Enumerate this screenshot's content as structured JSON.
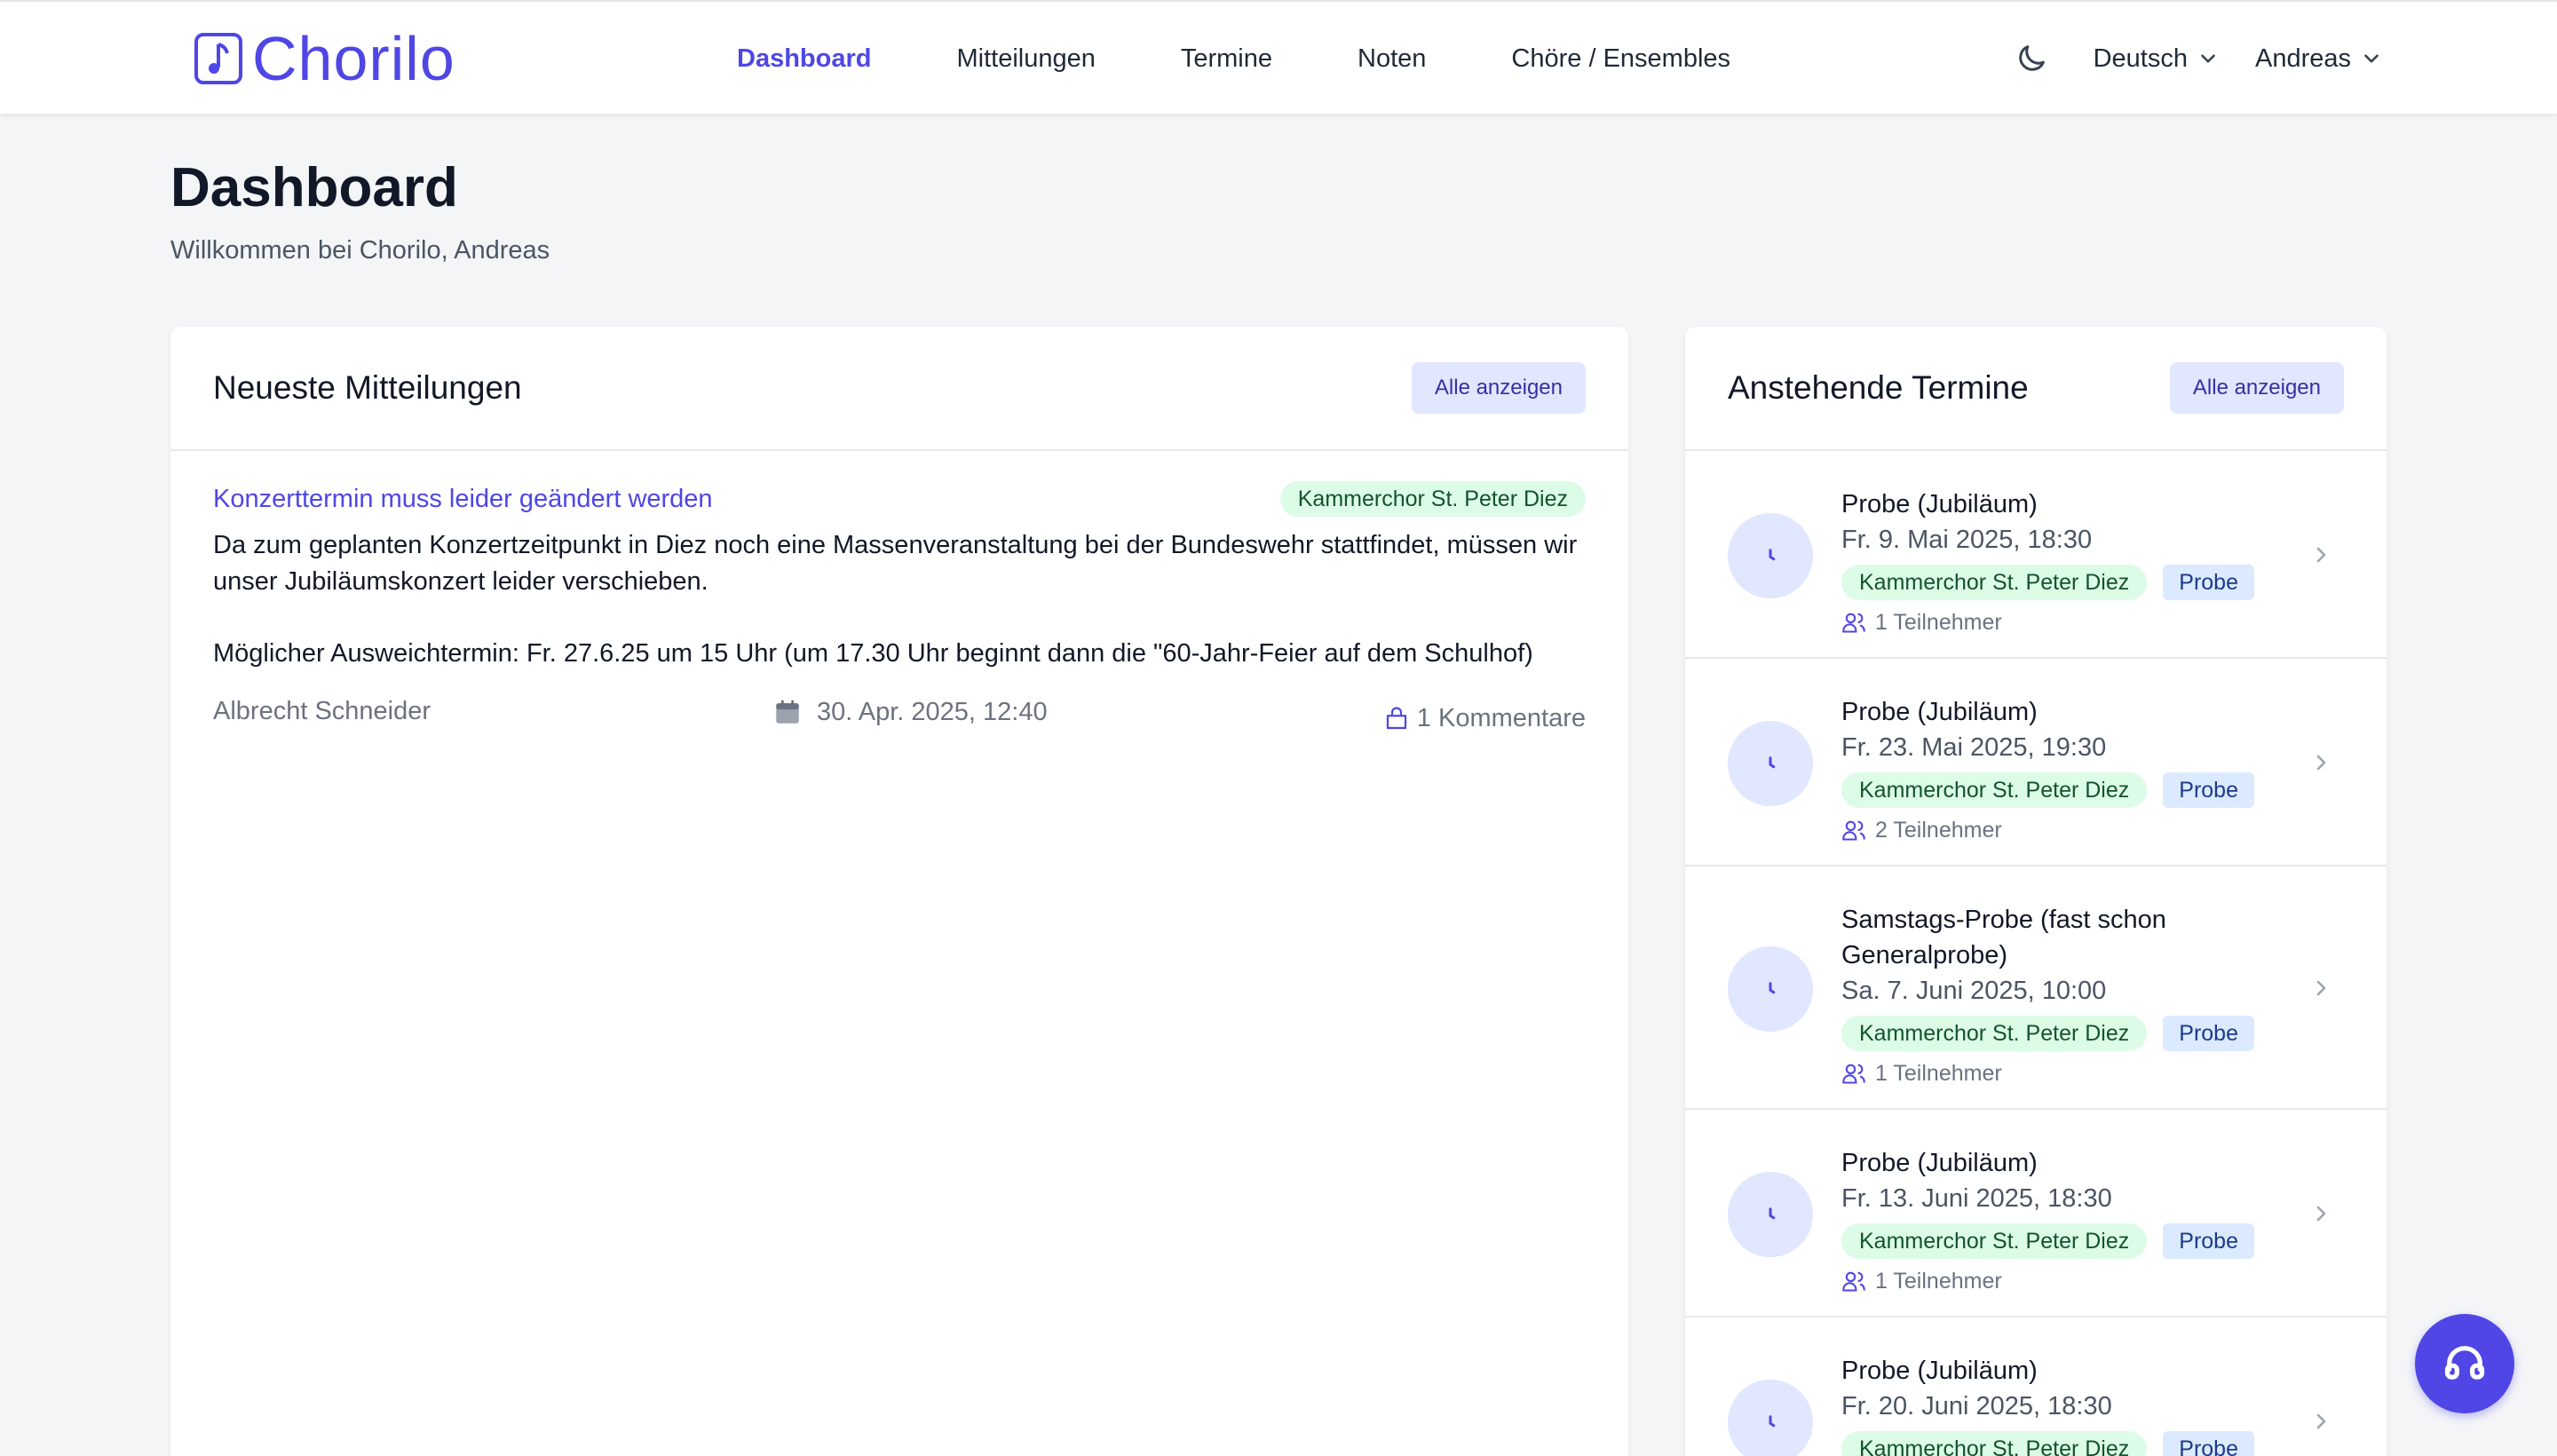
{
  "app": {
    "name": "Chorilo"
  },
  "nav": {
    "items": [
      {
        "label": "Dashboard",
        "active": true
      },
      {
        "label": "Mitteilungen",
        "active": false
      },
      {
        "label": "Termine",
        "active": false
      },
      {
        "label": "Noten",
        "active": false
      },
      {
        "label": "Chöre / Ensembles",
        "active": false
      }
    ],
    "language": "Deutsch",
    "user": "Andreas"
  },
  "page": {
    "title": "Dashboard",
    "subtitle": "Willkommen bei Chorilo, Andreas"
  },
  "messages_card": {
    "title": "Neueste Mitteilungen",
    "view_all": "Alle anzeigen",
    "items": [
      {
        "title": "Konzerttermin muss leider geändert werden",
        "group": "Kammerchor St. Peter Diez",
        "body_1": "Da zum geplanten Konzertzeitpunkt in Diez noch eine Massenveranstaltung bei der Bundeswehr stattfindet, müssen wir unser Jubiläumskonzert leider verschieben.",
        "body_2": "Möglicher Ausweichtermin: Fr. 27.6.25 um 15 Uhr (um 17.30 Uhr beginnt dann die \"60-Jahr-Feier auf dem Schulhof)",
        "author": "Albrecht Schneider",
        "date": "30. Apr. 2025, 12:40",
        "comments": "1 Kommentare"
      }
    ]
  },
  "events_card": {
    "title": "Anstehende Termine",
    "view_all": "Alle anzeigen",
    "items": [
      {
        "title": "Probe (Jubiläum)",
        "date": "Fr. 9. Mai 2025, 18:30",
        "group": "Kammerchor St. Peter Diez",
        "type": "Probe",
        "participants": "1 Teilnehmer"
      },
      {
        "title": "Probe (Jubiläum)",
        "date": "Fr. 23. Mai 2025, 19:30",
        "group": "Kammerchor St. Peter Diez",
        "type": "Probe",
        "participants": "2 Teilnehmer"
      },
      {
        "title": "Samstags-Probe (fast schon Generalprobe)",
        "date": "Sa. 7. Juni 2025, 10:00",
        "group": "Kammerchor St. Peter Diez",
        "type": "Probe",
        "participants": "1 Teilnehmer"
      },
      {
        "title": "Probe (Jubiläum)",
        "date": "Fr. 13. Juni 2025, 18:30",
        "group": "Kammerchor St. Peter Diez",
        "type": "Probe",
        "participants": "1 Teilnehmer"
      },
      {
        "title": "Probe (Jubiläum)",
        "date": "Fr. 20. Juni 2025, 18:30",
        "group": "Kammerchor St. Peter Diez",
        "type": "Probe",
        "participants": ""
      }
    ]
  },
  "colors": {
    "accent": "#4f46e5",
    "badge_green_bg": "#dcfce7",
    "badge_blue_bg": "#dbeafe",
    "page_bg": "#f4f5f7"
  },
  "icons": {
    "logo": "music-note-icon",
    "theme": "moon-icon",
    "event": "clock-icon",
    "participants": "users-icon",
    "date": "calendar-icon",
    "comments": "comment-icon",
    "support": "headset-icon"
  }
}
